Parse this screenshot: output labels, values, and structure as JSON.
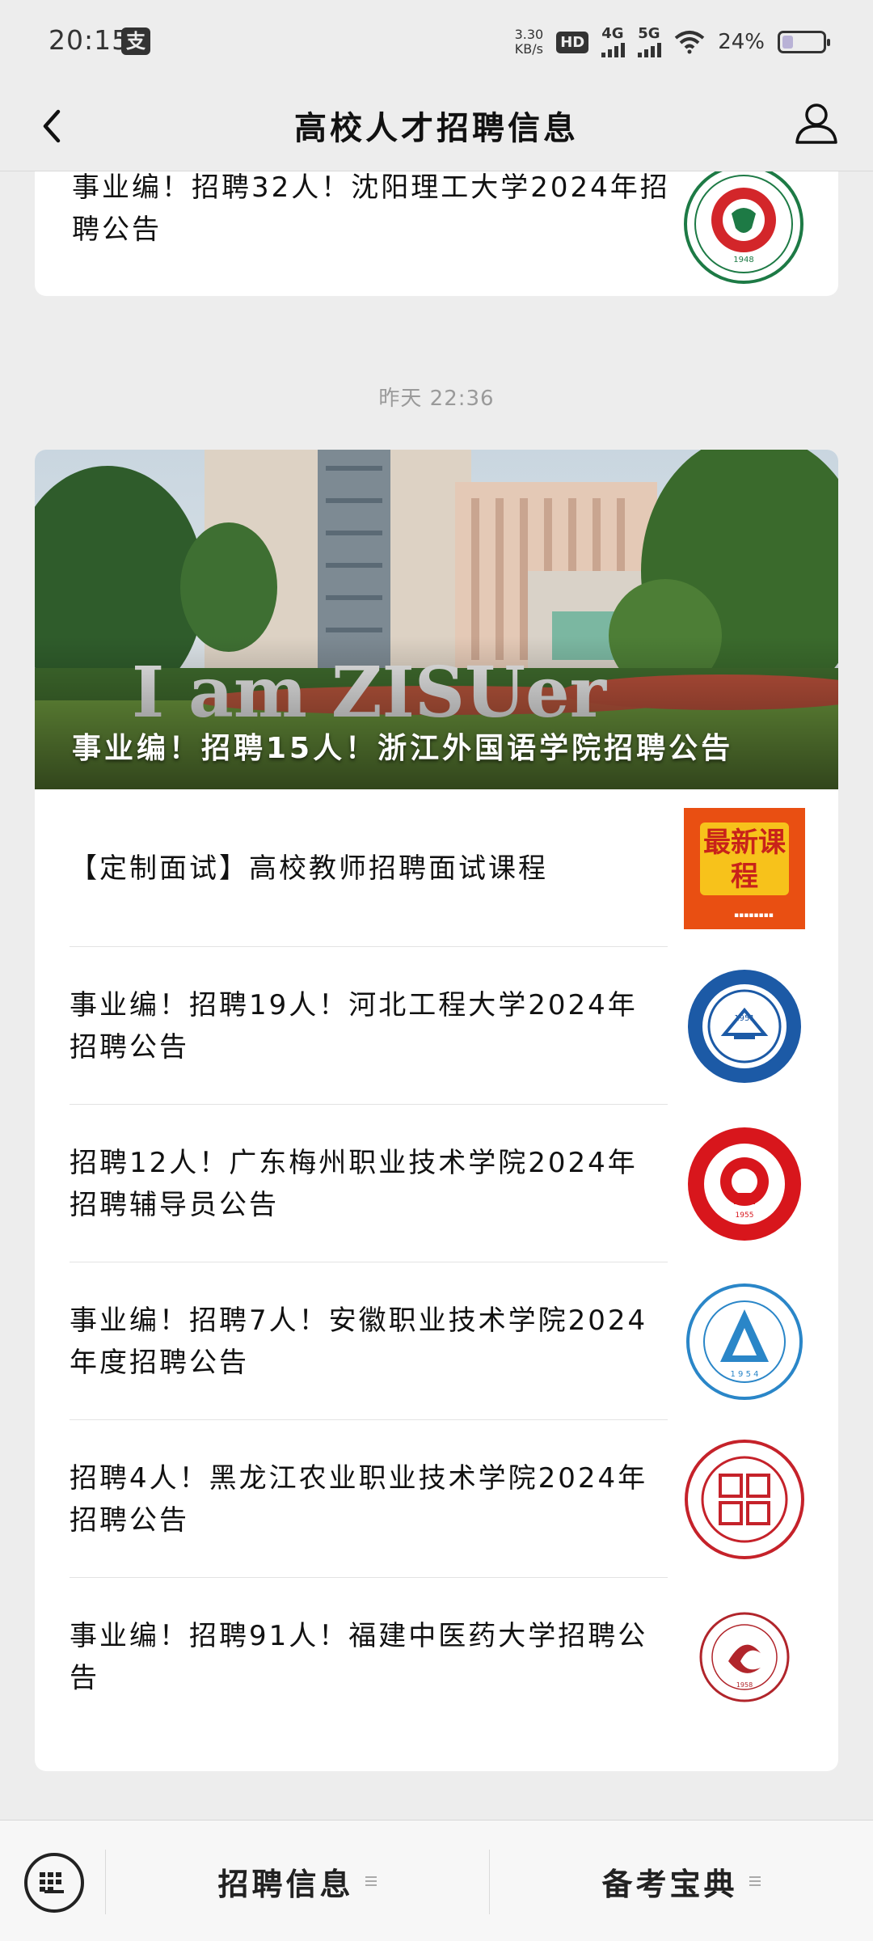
{
  "status_bar": {
    "time": "20:15",
    "pay_icon": "alipay-icon",
    "speed_value": "3.30",
    "speed_unit": "KB/s",
    "hd_label": "HD",
    "net1": "4G",
    "net2": "5G",
    "battery_text": "24%",
    "battery_level": 0.24
  },
  "nav": {
    "title": "高校人才招聘信息"
  },
  "top_card": {
    "title": "事业编！招聘32人！沈阳理工大学2024年招聘公告",
    "logo": "shenyang-ligong-university-logo"
  },
  "timestamp": "昨天 22:36",
  "main_card": {
    "hero_title": "事业编！招聘15人！浙江外国语学院招聘公告",
    "hero_sign": "I am ZISUer",
    "items": [
      {
        "title": "【定制面试】高校教师招聘面试课程",
        "logo_text": "最新课程"
      },
      {
        "title": "事业编！招聘19人！河北工程大学2024年招聘公告"
      },
      {
        "title": "招聘12人！广东梅州职业技术学院2024年招聘辅导员公告"
      },
      {
        "title": "事业编！招聘7人！安徽职业技术学院2024年度招聘公告"
      },
      {
        "title": "招聘4人！黑龙江农业职业技术学院2024年招聘公告"
      },
      {
        "title": "事业编！招聘91人！福建中医药大学招聘公告"
      }
    ]
  },
  "bottom_bar": {
    "menu1": "招聘信息",
    "menu2": "备考宝典"
  },
  "colors": {
    "background": "#ededed",
    "card": "#ffffff",
    "accent_red": "#c8221a",
    "accent_blue": "#1c5aa6"
  }
}
